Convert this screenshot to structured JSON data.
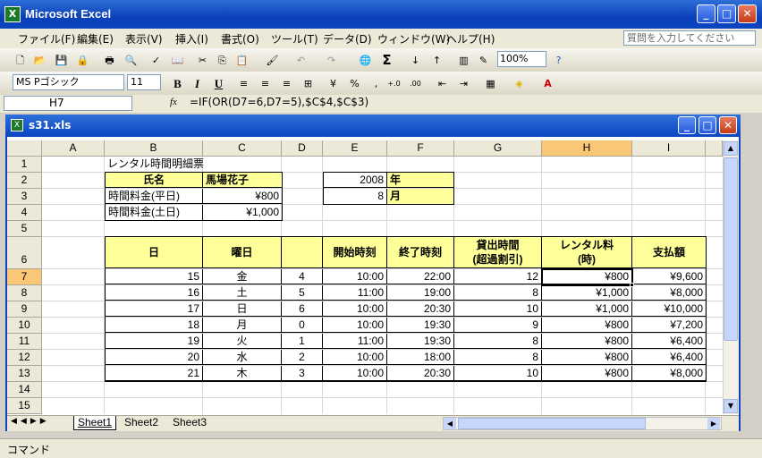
{
  "app": {
    "title": "Microsoft Excel",
    "icon": "excel-icon"
  },
  "menu": [
    "ファイル(F)",
    "編集(E)",
    "表示(V)",
    "挿入(I)",
    "書式(O)",
    "ツール(T)",
    "データ(D)",
    "ウィンドウ(W)",
    "ヘルプ(H)"
  ],
  "help_placeholder": "質問を入力してください",
  "toolbar": {
    "zoom": "100%",
    "font": "MS Pゴシック",
    "size": "11"
  },
  "formula": {
    "cell": "H7",
    "fx": "fx",
    "text": "=IF(OR(D7=6,D7=5),$C$4,$C$3)"
  },
  "workbook": {
    "title": "s31.xls"
  },
  "columns": [
    "A",
    "B",
    "C",
    "D",
    "E",
    "F",
    "G",
    "H",
    "I"
  ],
  "rows": [
    "1",
    "2",
    "3",
    "4",
    "5",
    "6",
    "7",
    "8",
    "9",
    "10",
    "11",
    "12",
    "13",
    "14",
    "15"
  ],
  "sheet": {
    "b1": "レンタル時間明細票",
    "b2": "氏名",
    "c2": "馬場花子",
    "b3": "時間料金(平日)",
    "c3": "¥800",
    "b4": "時間料金(土日)",
    "c4": "¥1,000",
    "e2": "2008",
    "f2": "年",
    "e3": "8",
    "f3": "月",
    "headers": {
      "b": "日",
      "c": "曜日",
      "e": "開始時刻",
      "f": "終了時刻",
      "g1": "貸出時間",
      "g2": "(超過割引)",
      "h1": "レンタル料",
      "h2": "(時)",
      "i": "支払額"
    },
    "data": [
      [
        "15",
        "金",
        "4",
        "10:00",
        "22:00",
        "12",
        "¥800",
        "¥9,600"
      ],
      [
        "16",
        "土",
        "5",
        "11:00",
        "19:00",
        "8",
        "¥1,000",
        "¥8,000"
      ],
      [
        "17",
        "日",
        "6",
        "10:00",
        "20:30",
        "10",
        "¥1,000",
        "¥10,000"
      ],
      [
        "18",
        "月",
        "0",
        "10:00",
        "19:30",
        "9",
        "¥800",
        "¥7,200"
      ],
      [
        "19",
        "火",
        "1",
        "11:00",
        "19:30",
        "8",
        "¥800",
        "¥6,400"
      ],
      [
        "20",
        "水",
        "2",
        "10:00",
        "18:00",
        "8",
        "¥800",
        "¥6,400"
      ],
      [
        "21",
        "木",
        "3",
        "10:00",
        "20:30",
        "10",
        "¥800",
        "¥8,000"
      ]
    ]
  },
  "tabs": [
    "Sheet1",
    "Sheet2",
    "Sheet3"
  ],
  "status": "コマンド",
  "colors": {
    "header_yellow": "#ffff99",
    "selected_header": "#f9c775",
    "title_blue": "#0a46c0"
  }
}
